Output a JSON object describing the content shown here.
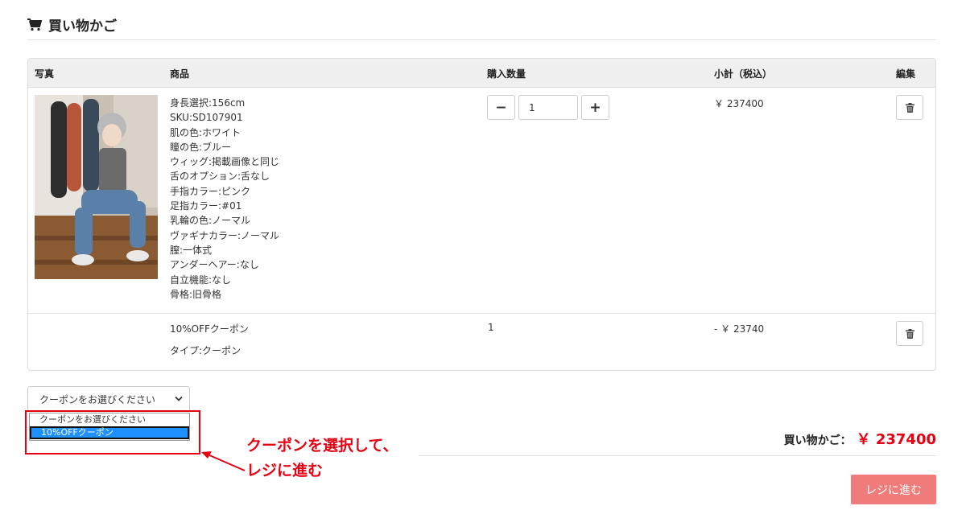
{
  "page": {
    "title": "買い物かご"
  },
  "table": {
    "headers": {
      "photo": "写真",
      "product": "商品",
      "quantity": "購入数量",
      "subtotal": "小計（税込）",
      "edit": "編集"
    },
    "item": {
      "options": [
        "身長選択:156cm",
        "SKU:SD107901",
        "肌の色:ホワイト",
        "瞳の色:ブルー",
        "ウィッグ:掲載画像と同じ",
        "舌のオプション:舌なし",
        "手指カラー:ピンク",
        "足指カラー:#01",
        "乳輪の色:ノーマル",
        "ヴァギナカラー:ノーマル",
        "膣:一体式",
        "アンダーヘアー:なし",
        "自立機能:なし",
        "骨格:旧骨格"
      ],
      "quantity": "1",
      "minus": "−",
      "plus": "+",
      "subtotal": "￥ 237400"
    },
    "coupon": {
      "name": "10%OFFクーポン",
      "type": "タイプ:クーポン",
      "quantity": "1",
      "subtotal": "- ￥ 23740"
    }
  },
  "coupon_select": {
    "value": "クーポンをお選びください",
    "options": [
      "クーポンをお選びください",
      "10%OFFクーポン"
    ]
  },
  "annotation": {
    "line1": "クーポンを選択して、",
    "line2": "レジに進む"
  },
  "total": {
    "label": "買い物かご：",
    "amount": "￥ 237400"
  },
  "checkout_label": "レジに進む",
  "colors": {
    "accent_red": "#e60012",
    "checkout_bg": "#f07b7b",
    "selected_option": "#1e90ff"
  }
}
